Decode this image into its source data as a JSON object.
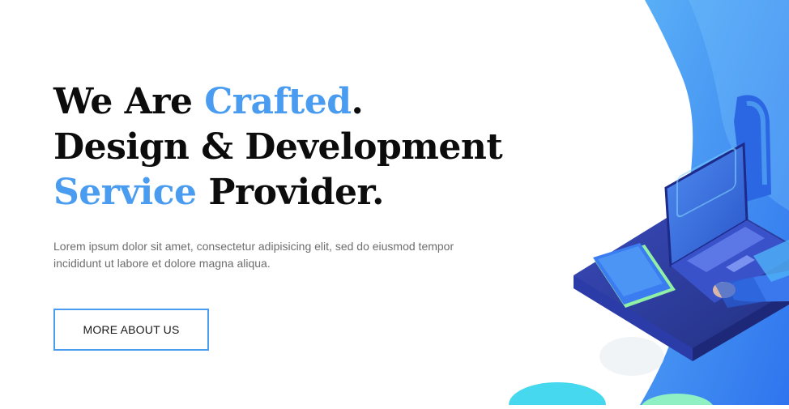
{
  "hero": {
    "headline": {
      "line1_prefix": "We Are ",
      "line1_accent": "Crafted",
      "line1_suffix": ".",
      "line2": "Design & Development",
      "line3_accent": "Service",
      "line3_suffix": " Provider."
    },
    "description": "Lorem ipsum dolor sit amet, consectetur adipisicing elit, sed do eiusmod tempor incididunt ut labore et dolore magna aliqua.",
    "cta_label": "MORE ABOUT US"
  },
  "colors": {
    "accent": "#4a9cf0",
    "heading": "#0c0c0c",
    "body_text": "#6d6d6d",
    "illustration_blue": "#2b6de8",
    "illustration_light": "#4fb3f7"
  }
}
